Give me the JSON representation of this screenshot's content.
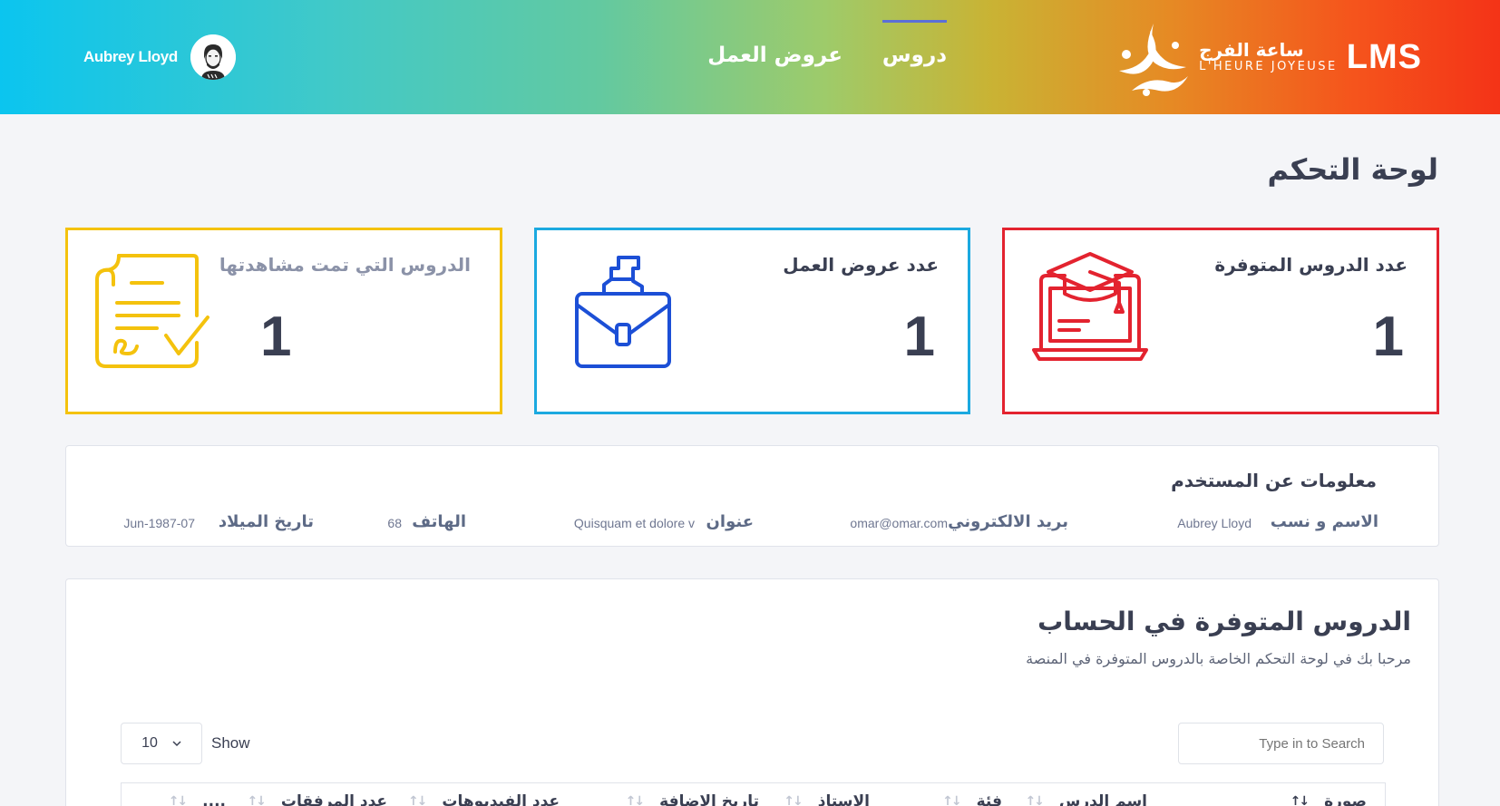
{
  "header": {
    "user_name": "Aubrey Lloyd",
    "nav": [
      {
        "label": "دروس",
        "active": true
      },
      {
        "label": "عروض العمل",
        "active": false
      }
    ],
    "logo_arabic": "ساعة الفرج",
    "logo_french": "L'HEURE JOYEUSE",
    "logo_lms": "LMS"
  },
  "page_title": "لوحة التحكم",
  "stats": [
    {
      "label": "عدد الدروس المتوفرة",
      "value": "1",
      "color": "#e3232f",
      "icon": "graduation-laptop-icon"
    },
    {
      "label": "عدد عروض العمل",
      "value": "1",
      "color": "#1ba9e0",
      "icon": "briefcase-icon"
    },
    {
      "label": "الدروس التي تمت مشاهدتها",
      "value": "1",
      "color": "#f4c20d",
      "icon": "certificate-icon"
    }
  ],
  "user_info": {
    "title": "معلومات عن المستخدم",
    "fields": [
      {
        "label": "الاسم و نسب",
        "value": "Aubrey Lloyd"
      },
      {
        "label": "بريد الالكتروني",
        "value": "omar@omar.com"
      },
      {
        "label": "عنوان",
        "value": "Quisquam et dolore v"
      },
      {
        "label": "الهاتف",
        "value": "68"
      },
      {
        "label": "تاريخ الميلاد",
        "value": "Jun-1987-07"
      }
    ]
  },
  "courses": {
    "title": "الدروس المتوفرة في الحساب",
    "subtitle": "مرحبا بك في لوحة التحكم الخاصة بالدروس المتوفرة في المنصة",
    "search_placeholder": "Type in to Search",
    "show_label": "Show",
    "page_length": "10",
    "columns": [
      "صورة",
      "اسم الدرس",
      "فئة",
      "الاستاذ",
      "تاريخ الاضافة",
      "عدد الفيديوهات",
      "عدد المرفقات",
      "...."
    ]
  }
}
